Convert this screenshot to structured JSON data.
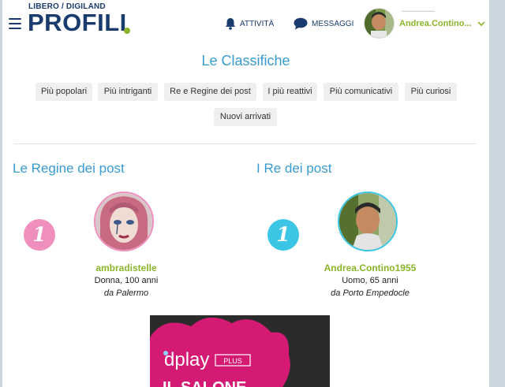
{
  "header": {
    "logo_top": "LIBERO / DIGILAND",
    "logo_main": "PROFILI",
    "nav": {
      "activity_label": "ATTIVITÀ",
      "messages_label": "MESSAGGI"
    },
    "user_name": "Andrea.Contino..."
  },
  "page_title": "Le Classifiche",
  "tabs": [
    {
      "label": "Più popolari"
    },
    {
      "label": "Più intriganti"
    },
    {
      "label": "Re e Regine dei post"
    },
    {
      "label": "I più reattivi"
    },
    {
      "label": "Più comunicativi"
    },
    {
      "label": "Più curiosi"
    },
    {
      "label": "Nuovi arrivati"
    }
  ],
  "columns": {
    "queens": {
      "title": "Le Regine dei post",
      "rank": "1",
      "name": "ambradistelle",
      "info": "Donna, 100 anni",
      "city": "da Palermo",
      "accent": "#ef8fbd"
    },
    "kings": {
      "title": "I Re dei post",
      "rank": "1",
      "name": "Andrea.Contino1955",
      "info": "Uomo, 65 anni",
      "city": "da Porto Empedocle",
      "accent": "#3cc6e6"
    }
  },
  "ad": {
    "brand": "dplay",
    "badge": "PLUS",
    "headline": "IL SALONE"
  },
  "colors": {
    "navy": "#1a3b6e",
    "blue": "#3a9bd0",
    "green": "#8ab52b"
  }
}
